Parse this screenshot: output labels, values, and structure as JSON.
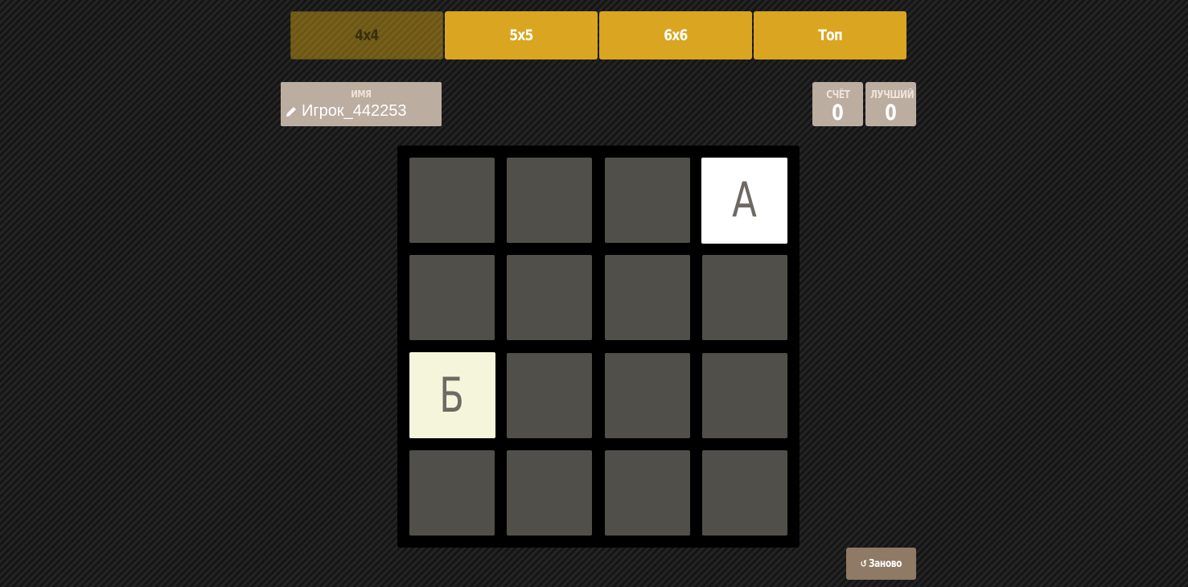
{
  "tabs": [
    {
      "label": "4x4",
      "active": true
    },
    {
      "label": "5x5",
      "active": false
    },
    {
      "label": "6x6",
      "active": false
    },
    {
      "label": "Топ",
      "active": false
    }
  ],
  "player": {
    "label": "имя",
    "name": "Игрок_442253",
    "edit_icon": "pencil-icon"
  },
  "scores": {
    "score_label": "счёт",
    "score_value": "0",
    "best_label": "лучший",
    "best_value": "0"
  },
  "board": {
    "size": 4,
    "tiles": [
      {
        "row": 0,
        "col": 3,
        "letter": "А",
        "color": "#ffffff"
      },
      {
        "row": 2,
        "col": 0,
        "letter": "Б",
        "color": "#f5f5dc"
      }
    ]
  },
  "restart": {
    "icon": "restart-icon",
    "label": "Заново"
  },
  "colors": {
    "tab": "#daa520",
    "tab_active": "#6e5818",
    "panel": "#bbada0",
    "cell": "#514f4a",
    "board": "#000000",
    "button": "#8f7a66"
  }
}
